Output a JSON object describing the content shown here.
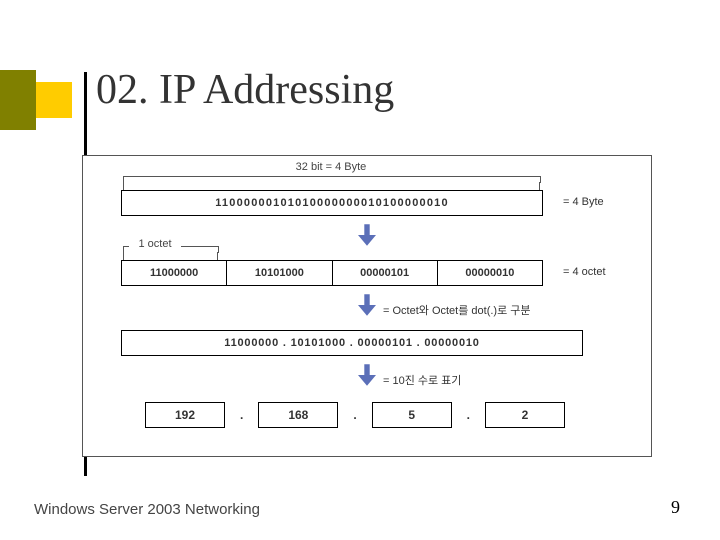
{
  "slide": {
    "title": "02. IP Addressing",
    "footer_left": "Windows  Server 2003 Networking",
    "footer_right": "9"
  },
  "diagram": {
    "top_bracket_label": "32 bit = 4 Byte",
    "row1": {
      "bits": "11000000101010000000010100000010",
      "side": "= 4 Byte"
    },
    "octet_bracket_label": "1 octet",
    "row2": {
      "o1": "11000000",
      "o2": "10101000",
      "o3": "00000101",
      "o4": "00000010",
      "side": "= 4 octet"
    },
    "mid_label_1": "= Octet와 Octet를 dot(.)로 구분",
    "row3": {
      "text": "11000000 . 10101000 . 00000101 . 00000010"
    },
    "mid_label_2": "= 10진 수로  표기",
    "row4": {
      "a": "192",
      "b": "168",
      "c": "5",
      "d": "2",
      "dot": "."
    }
  }
}
